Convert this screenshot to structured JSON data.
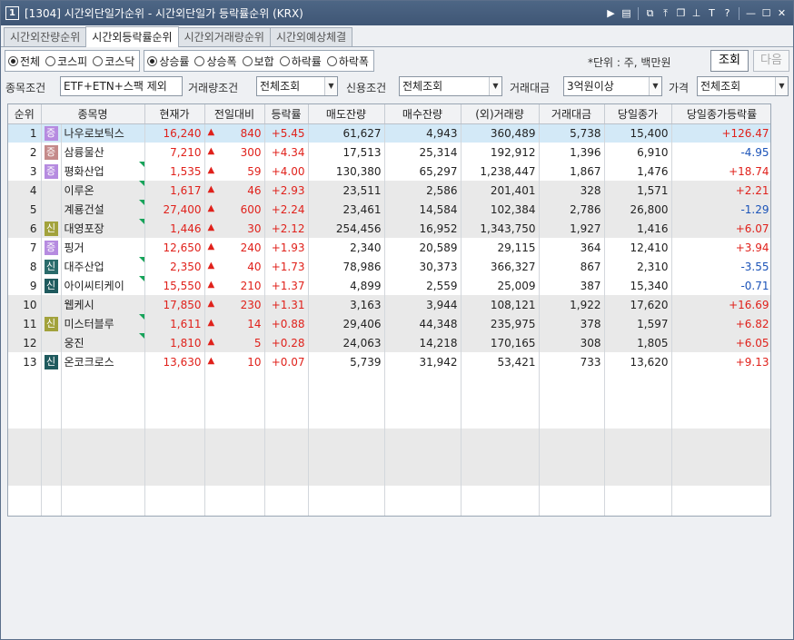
{
  "window": {
    "number": "1",
    "title": "[1304]  시간외단일가순위 - 시간외단일가 등락률순위 (KRX)"
  },
  "tabs": [
    {
      "label": "시간외잔량순위",
      "active": false
    },
    {
      "label": "시간외등락률순위",
      "active": true
    },
    {
      "label": "시간외거래량순위",
      "active": false
    },
    {
      "label": "시간외예상체결",
      "active": false
    }
  ],
  "market_radios": [
    {
      "label": "전체",
      "checked": true
    },
    {
      "label": "코스피",
      "checked": false
    },
    {
      "label": "코스닥",
      "checked": false
    }
  ],
  "sort_radios": [
    {
      "label": "상승률",
      "checked": true
    },
    {
      "label": "상승폭",
      "checked": false
    },
    {
      "label": "보합",
      "checked": false
    },
    {
      "label": "하락률",
      "checked": false
    },
    {
      "label": "하락폭",
      "checked": false
    }
  ],
  "unit_text": "*단위 : 주, 백만원",
  "buttons": {
    "query": "조회",
    "next": "다음"
  },
  "filters": {
    "stock_cond": {
      "label": "종목조건",
      "value": "ETF+ETN+스팩 제외"
    },
    "volume_cond": {
      "label": "거래량조건",
      "value": "전체조회"
    },
    "credit_cond": {
      "label": "신용조건",
      "value": "전체조회"
    },
    "amount_cond": {
      "label": "거래대금",
      "value": "3억원이상"
    },
    "price_cond": {
      "label": "가격",
      "value": "전체조회"
    }
  },
  "table": {
    "headers": [
      "순위",
      "종목명",
      "현재가",
      "전일대비",
      "등락률",
      "매도잔량",
      "매수잔량",
      "(외)거래량",
      "거래대금",
      "당일종가",
      "당일종가등락률"
    ],
    "rows": [
      {
        "rank": "1",
        "tag": "증",
        "tag_color": "purple",
        "name": "나우로보틱스",
        "price": "16,240",
        "change": "840",
        "rate": "+5.45",
        "ask": "61,627",
        "bid": "4,943",
        "volume": "360,489",
        "amount": "5,738",
        "close": "15,400",
        "close_rate": "+126.47",
        "close_dir": "up",
        "flag": false,
        "style": "sel"
      },
      {
        "rank": "2",
        "tag": "증",
        "tag_color": "rose",
        "name": "삼륭물산",
        "price": "7,210",
        "change": "300",
        "rate": "+4.34",
        "ask": "17,513",
        "bid": "25,314",
        "volume": "192,912",
        "amount": "1,396",
        "close": "6,910",
        "close_rate": "-4.95",
        "close_dir": "dn",
        "flag": false,
        "style": "white"
      },
      {
        "rank": "3",
        "tag": "증",
        "tag_color": "purple",
        "name": "평화산업",
        "price": "1,535",
        "change": "59",
        "rate": "+4.00",
        "ask": "130,380",
        "bid": "65,297",
        "volume": "1,238,447",
        "amount": "1,867",
        "close": "1,476",
        "close_rate": "+18.74",
        "close_dir": "up",
        "flag": true,
        "style": "white"
      },
      {
        "rank": "4",
        "tag": "",
        "tag_color": "",
        "name": "이루온",
        "price": "1,617",
        "change": "46",
        "rate": "+2.93",
        "ask": "23,511",
        "bid": "2,586",
        "volume": "201,401",
        "amount": "328",
        "close": "1,571",
        "close_rate": "+2.21",
        "close_dir": "up",
        "flag": true,
        "style": "gray"
      },
      {
        "rank": "5",
        "tag": "",
        "tag_color": "",
        "name": "계룡건설",
        "price": "27,400",
        "change": "600",
        "rate": "+2.24",
        "ask": "23,461",
        "bid": "14,584",
        "volume": "102,384",
        "amount": "2,786",
        "close": "26,800",
        "close_rate": "-1.29",
        "close_dir": "dn",
        "flag": true,
        "style": "gray"
      },
      {
        "rank": "6",
        "tag": "신",
        "tag_color": "olive",
        "name": "대영포장",
        "price": "1,446",
        "change": "30",
        "rate": "+2.12",
        "ask": "254,456",
        "bid": "16,952",
        "volume": "1,343,750",
        "amount": "1,927",
        "close": "1,416",
        "close_rate": "+6.07",
        "close_dir": "up",
        "flag": true,
        "style": "gray"
      },
      {
        "rank": "7",
        "tag": "증",
        "tag_color": "purple",
        "name": "핑거",
        "price": "12,650",
        "change": "240",
        "rate": "+1.93",
        "ask": "2,340",
        "bid": "20,589",
        "volume": "29,115",
        "amount": "364",
        "close": "12,410",
        "close_rate": "+3.94",
        "close_dir": "up",
        "flag": false,
        "style": "white"
      },
      {
        "rank": "8",
        "tag": "신",
        "tag_color": "teal",
        "name": "대주산업",
        "price": "2,350",
        "change": "40",
        "rate": "+1.73",
        "ask": "78,986",
        "bid": "30,373",
        "volume": "366,327",
        "amount": "867",
        "close": "2,310",
        "close_rate": "-3.55",
        "close_dir": "dn",
        "flag": true,
        "style": "white"
      },
      {
        "rank": "9",
        "tag": "신",
        "tag_color": "navy",
        "name": "아이씨티케이",
        "price": "15,550",
        "change": "210",
        "rate": "+1.37",
        "ask": "4,899",
        "bid": "2,559",
        "volume": "25,009",
        "amount": "387",
        "close": "15,340",
        "close_rate": "-0.71",
        "close_dir": "dn",
        "flag": true,
        "style": "white"
      },
      {
        "rank": "10",
        "tag": "",
        "tag_color": "",
        "name": "웹케시",
        "price": "17,850",
        "change": "230",
        "rate": "+1.31",
        "ask": "3,163",
        "bid": "3,944",
        "volume": "108,121",
        "amount": "1,922",
        "close": "17,620",
        "close_rate": "+16.69",
        "close_dir": "up",
        "flag": false,
        "style": "gray"
      },
      {
        "rank": "11",
        "tag": "신",
        "tag_color": "olive",
        "name": "미스터블루",
        "price": "1,611",
        "change": "14",
        "rate": "+0.88",
        "ask": "29,406",
        "bid": "44,348",
        "volume": "235,975",
        "amount": "378",
        "close": "1,597",
        "close_rate": "+6.82",
        "close_dir": "up",
        "flag": true,
        "style": "gray"
      },
      {
        "rank": "12",
        "tag": "",
        "tag_color": "",
        "name": "웅진",
        "price": "1,810",
        "change": "5",
        "rate": "+0.28",
        "ask": "24,063",
        "bid": "14,218",
        "volume": "170,165",
        "amount": "308",
        "close": "1,805",
        "close_rate": "+6.05",
        "close_dir": "up",
        "flag": true,
        "style": "gray"
      },
      {
        "rank": "13",
        "tag": "신",
        "tag_color": "navy",
        "name": "온코크로스",
        "price": "13,630",
        "change": "10",
        "rate": "+0.07",
        "ask": "5,739",
        "bid": "31,942",
        "volume": "53,421",
        "amount": "733",
        "close": "13,620",
        "close_rate": "+9.13",
        "close_dir": "up",
        "flag": false,
        "style": "white"
      }
    ]
  },
  "colors": {
    "up": "#e0211b",
    "down": "#1b53b8",
    "selected_row": "#d3e9f7",
    "title_bar": "#46607f"
  }
}
